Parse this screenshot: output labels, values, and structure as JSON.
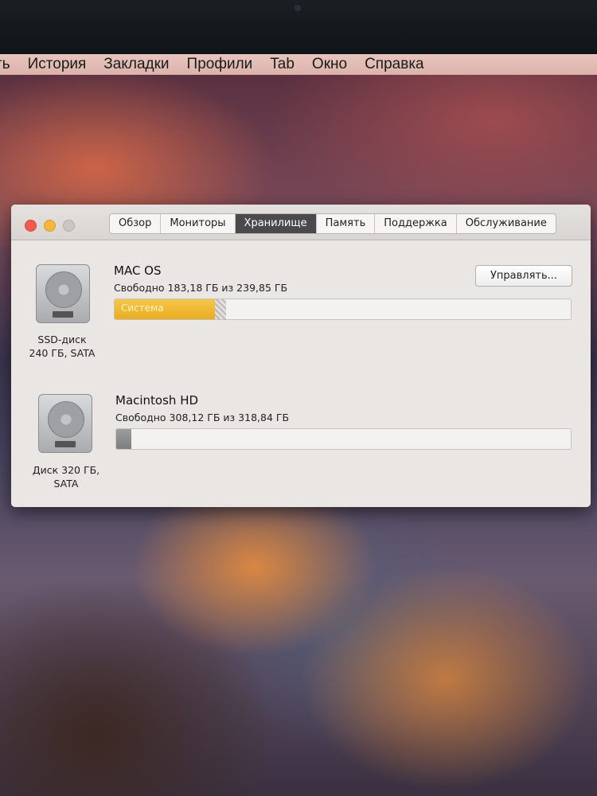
{
  "menubar": {
    "items": [
      "ть",
      "История",
      "Закладки",
      "Профили",
      "Tab",
      "Окно",
      "Справка"
    ]
  },
  "window": {
    "tabs": [
      {
        "label": "Обзор",
        "active": false
      },
      {
        "label": "Мониторы",
        "active": false
      },
      {
        "label": "Хранилище",
        "active": true
      },
      {
        "label": "Память",
        "active": false
      },
      {
        "label": "Поддержка",
        "active": false
      },
      {
        "label": "Обслуживание",
        "active": false
      }
    ],
    "manage_button": "Управлять...",
    "disks": [
      {
        "icon": "hard-drive-icon",
        "caption_line1": "SSD-диск",
        "caption_line2": "240 ГБ, SATA",
        "volume_name": "MAC OS",
        "free_text": "Свободно 183,18 ГБ из 239,85 ГБ",
        "segment_label": "Система",
        "system_fraction": 0.22,
        "other_fraction": 0.024
      },
      {
        "icon": "hard-drive-icon",
        "caption_line1": "Диск 320 ГБ,",
        "caption_line2": "SATA",
        "volume_name": "Macintosh HD",
        "free_text": "Свободно 308,12 ГБ из 318,84 ГБ",
        "used_fraction": 0.034
      }
    ]
  },
  "colors": {
    "system_segment": "#e9ad20",
    "active_tab": "#4a4a4c",
    "close": "#f05a4e",
    "minimize": "#f6b83c"
  }
}
